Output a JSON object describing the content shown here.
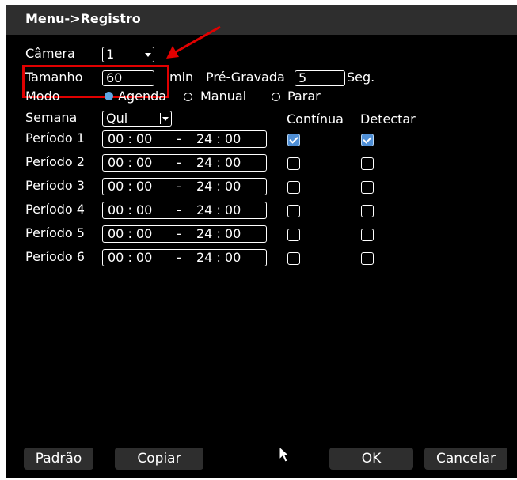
{
  "window": {
    "title": "Menu->Registro"
  },
  "camera": {
    "label": "Câmera",
    "value": "1"
  },
  "tamanho": {
    "label": "Tamanho",
    "value": "60",
    "unit": "min"
  },
  "pregravada": {
    "label": "Pré-Gravada",
    "value": "5",
    "unit": "Seg."
  },
  "modo": {
    "label": "Modo",
    "options": [
      {
        "label": "Agenda",
        "selected": true
      },
      {
        "label": "Manual",
        "selected": false
      },
      {
        "label": "Parar",
        "selected": false
      }
    ]
  },
  "semana": {
    "label": "Semana",
    "value": "Qui"
  },
  "columns": {
    "continua": "Contínua",
    "detectar": "Detectar"
  },
  "periods": [
    {
      "label": "Período 1",
      "start": "00 : 00",
      "sep": "-",
      "end": "24 : 00",
      "continua": true,
      "detectar": true
    },
    {
      "label": "Período 2",
      "start": "00 : 00",
      "sep": "-",
      "end": "24 : 00",
      "continua": false,
      "detectar": false
    },
    {
      "label": "Período 3",
      "start": "00 : 00",
      "sep": "-",
      "end": "24 : 00",
      "continua": false,
      "detectar": false
    },
    {
      "label": "Período 4",
      "start": "00 : 00",
      "sep": "-",
      "end": "24 : 00",
      "continua": false,
      "detectar": false
    },
    {
      "label": "Período 5",
      "start": "00 : 00",
      "sep": "-",
      "end": "24 : 00",
      "continua": false,
      "detectar": false
    },
    {
      "label": "Período 6",
      "start": "00 : 00",
      "sep": "-",
      "end": "24 : 00",
      "continua": false,
      "detectar": false
    }
  ],
  "buttons": {
    "padrao": "Padrão",
    "copiar": "Copiar",
    "ok": "OK",
    "cancelar": "Cancelar"
  },
  "colors": {
    "background": "#000000",
    "titlebar": "#2e2e2e",
    "accent": "#4f8fd6",
    "annotation": "#e00000"
  }
}
